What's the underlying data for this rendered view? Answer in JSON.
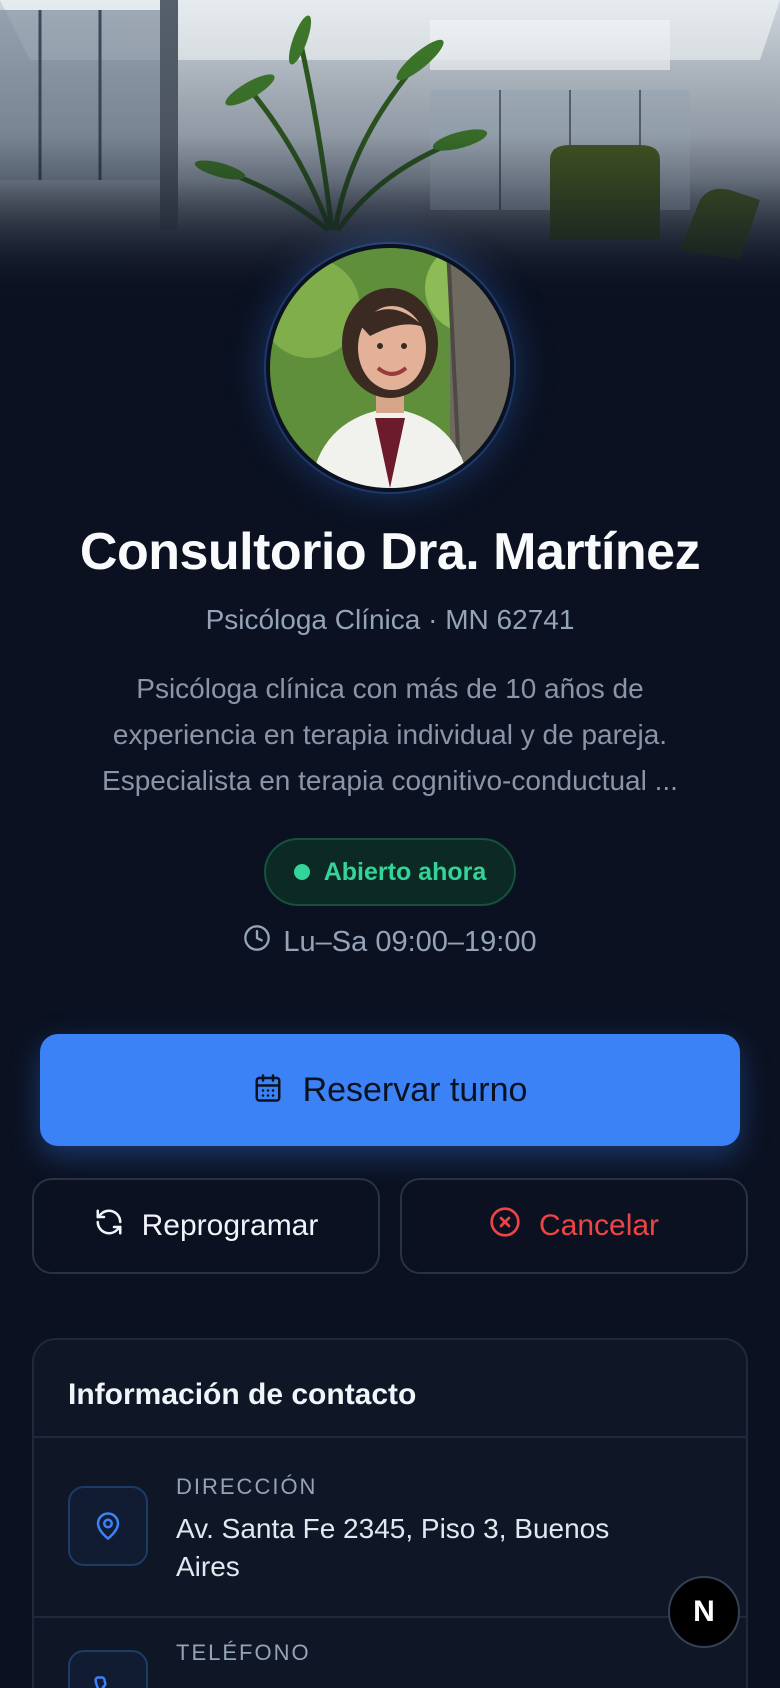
{
  "profile": {
    "name": "Consultorio Dra. Martínez",
    "subtitle": "Psicóloga Clínica · MN 62741",
    "description": "Psicóloga clínica con más de 10 años de experiencia en terapia individual y de pareja. Especialista en terapia cognitivo-conductual ...",
    "status": "Abierto ahora",
    "hours": "Lu–Sa 09:00–19:00"
  },
  "actions": {
    "book_label": "Reservar turno",
    "reschedule_label": "Reprogramar",
    "cancel_label": "Cancelar"
  },
  "contact": {
    "title": "Información de contacto",
    "address_label": "DIRECCIÓN",
    "address_value": "Av. Santa Fe 2345, Piso 3, Buenos Aires",
    "phone_label": "TELÉFONO"
  },
  "fab": {
    "label": "N"
  },
  "colors": {
    "background": "#0b1120",
    "accent": "#3b82f6",
    "open_green": "#34d399",
    "cancel_red": "#ef4444"
  },
  "icons": {
    "hero": "office-interior-image",
    "avatar": "doctor-portrait-image",
    "hours": "clock-icon",
    "book": "calendar-icon",
    "reschedule": "refresh-icon",
    "cancel": "x-circle-icon",
    "address": "map-pin-icon",
    "phone": "phone-icon"
  }
}
